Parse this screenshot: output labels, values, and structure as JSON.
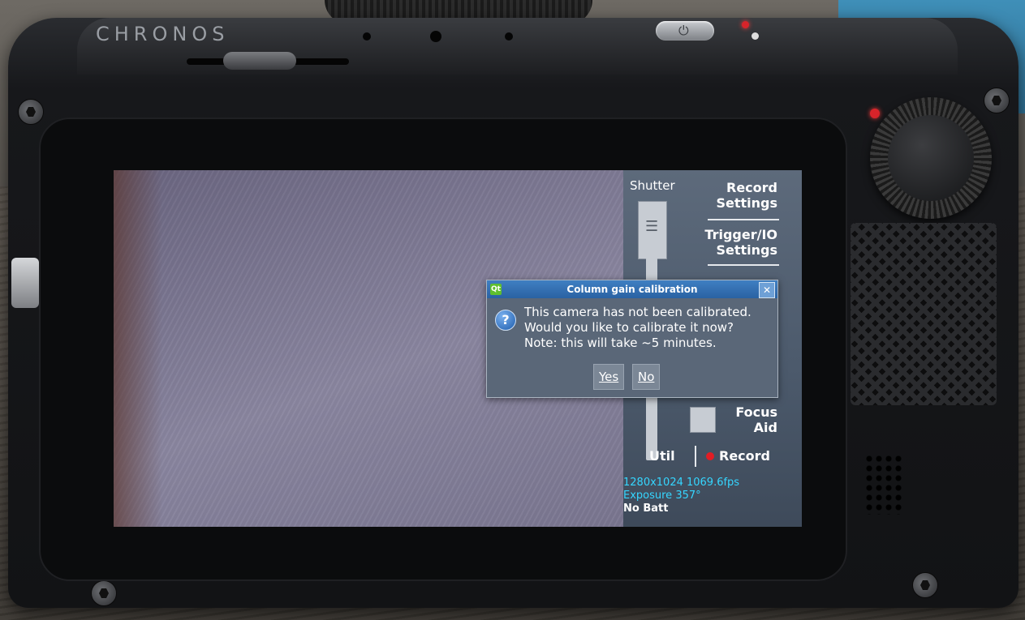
{
  "device": {
    "brand": "CHRONOS"
  },
  "panel": {
    "shutter_label": "Shutter",
    "record_settings": "Record Settings",
    "record_settings_line1": "Record",
    "record_settings_line2": "Settings",
    "trigger_io_line1": "Trigger/IO",
    "trigger_io_line2": "Settings",
    "focus_aid_line1": "Focus",
    "focus_aid_line2": "Aid",
    "util_label": "Util",
    "record_label": "Record",
    "resolution_fps": "1280x1024 1069.6fps",
    "exposure": "Exposure 357°",
    "battery": "No Batt"
  },
  "dialog": {
    "title": "Column gain calibration",
    "message_line1": "This camera has not been calibrated.",
    "message_line2": "Would you like to calibrate it now?",
    "message_line3": "Note: this will take ~5 minutes.",
    "yes_label": "Yes",
    "no_label": "No",
    "close_glyph": "✕",
    "question_glyph": "?"
  },
  "colors": {
    "panel_bg": "#4c5a6c",
    "info_text": "#35d6ff",
    "record_dot": "#e21d24",
    "dialog_title_bg": "#2a62a3"
  },
  "icons": [
    "power-icon",
    "question-icon",
    "close-icon",
    "record-dot-icon",
    "shutter-handle-icon"
  ]
}
